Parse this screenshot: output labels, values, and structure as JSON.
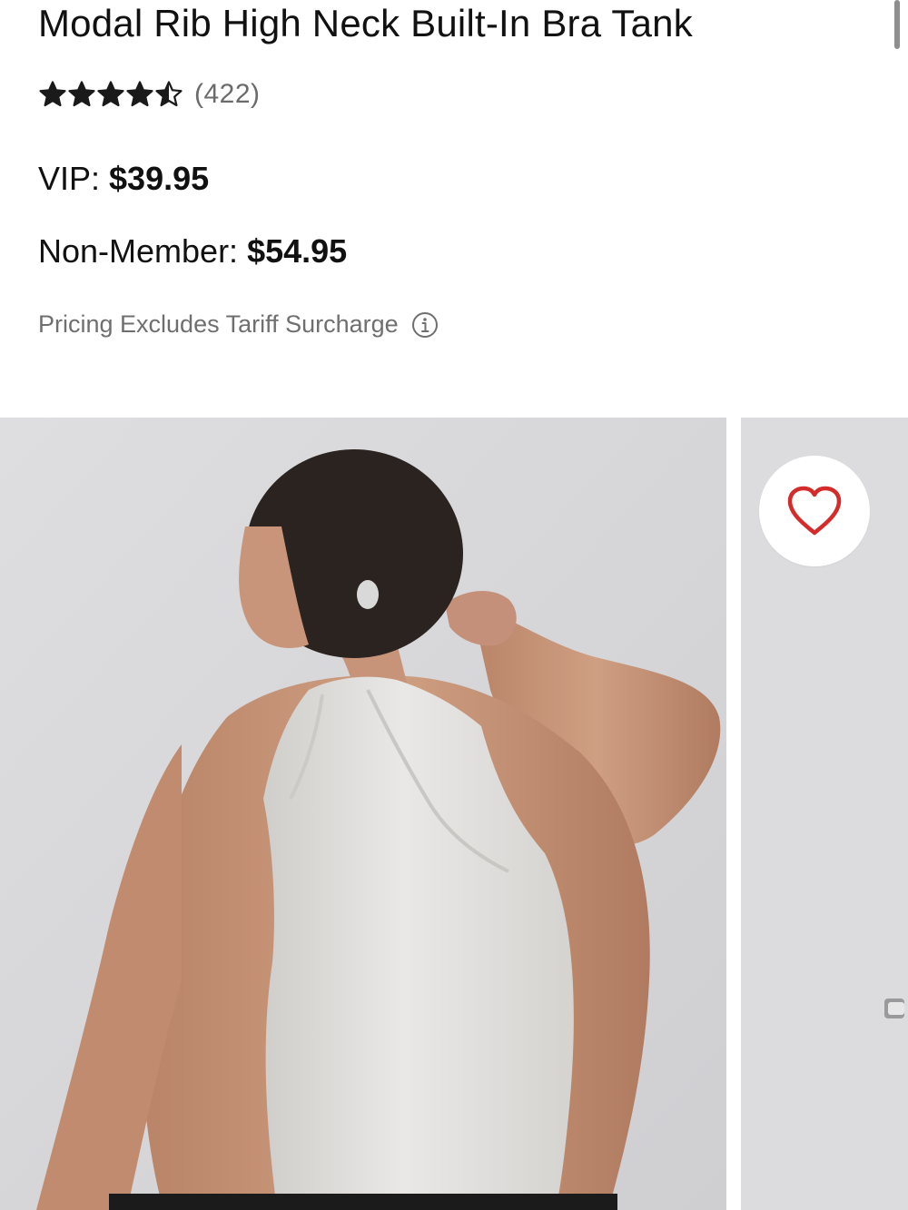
{
  "product": {
    "title": "Modal Rib High Neck Built-In Bra Tank",
    "rating": {
      "stars": 4.5,
      "max_stars": 5,
      "review_count": "(422)"
    },
    "prices": {
      "vip_label": "VIP:",
      "vip_value": "$39.95",
      "nonmember_label": "Non-Member:",
      "nonmember_value": "$54.95"
    },
    "tariff_note": "Pricing Excludes Tariff Surcharge",
    "tariff_icon": "info-icon"
  },
  "gallery": {
    "images": [
      {
        "alt": "Model wearing the heather grey racerback tank, back view"
      },
      {
        "alt": "Next product image, partially visible"
      }
    ],
    "wishlist_icon": "heart-icon"
  },
  "colors": {
    "star": "#1a1a1a",
    "heart": "#d52b2b",
    "muted_text": "#6f6f6f",
    "photo_bg": "#d9d9db",
    "tank": "#e6e5e3",
    "skin": "#c99a7c"
  }
}
